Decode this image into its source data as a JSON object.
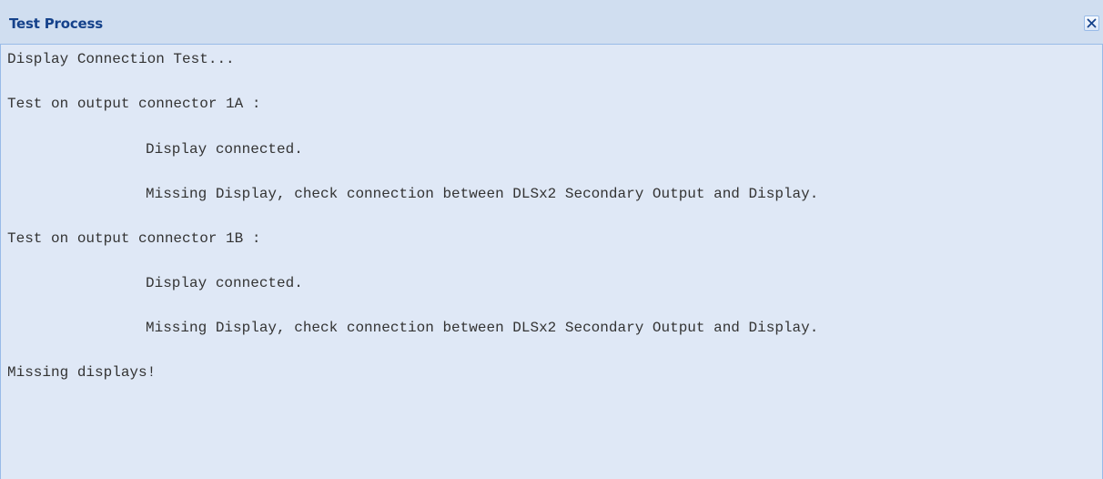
{
  "window": {
    "title": "Test Process",
    "close_icon": "close-icon"
  },
  "log": {
    "lines": [
      "Display Connection Test...",
      "Test on output connector 1A :",
      "Display connected.",
      "Missing Display, check connection between DLSx2 Secondary Output and Display.",
      "Test on output connector 1B :",
      "Display connected.",
      "Missing Display, check connection between DLSx2 Secondary Output and Display.",
      "Missing displays!"
    ]
  },
  "colors": {
    "titlebar_bg": "#d0def0",
    "title_text": "#15428b",
    "body_bg": "#dfe8f6",
    "border": "#99bbe8",
    "close_icon": "#15428b"
  }
}
